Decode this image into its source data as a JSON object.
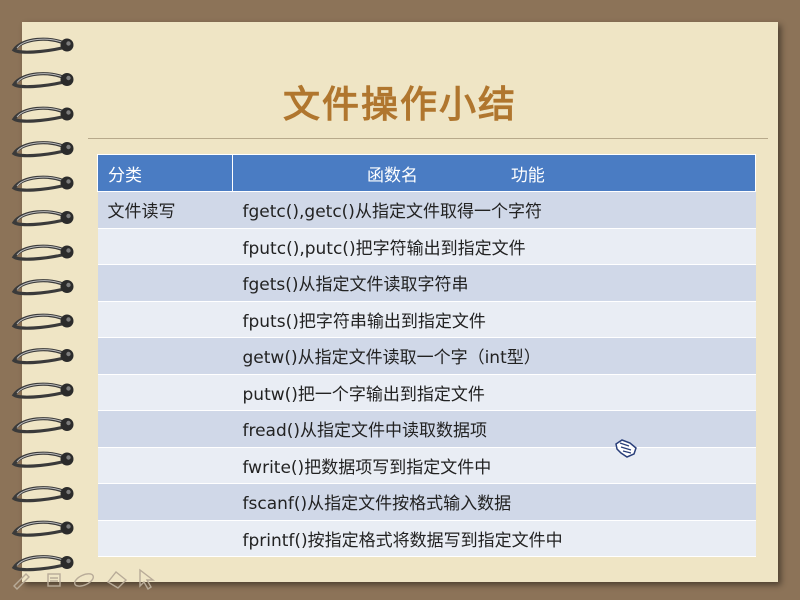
{
  "slide": {
    "title": "文件操作小结"
  },
  "table": {
    "headers": {
      "category": "分类",
      "function_name": "函数名",
      "purpose": "功能"
    },
    "rows": [
      {
        "category": "文件读写",
        "text": "fgetc(),getc()从指定文件取得一个字符"
      },
      {
        "category": "",
        "text": "fputc(),putc()把字符输出到指定文件"
      },
      {
        "category": "",
        "text": "fgets()从指定文件读取字符串"
      },
      {
        "category": "",
        "text": "fputs()把字符串输出到指定文件"
      },
      {
        "category": "",
        "text": "getw()从指定文件读取一个字（int型）"
      },
      {
        "category": "",
        "text": "putw()把一个字输出到指定文件"
      },
      {
        "category": "",
        "text": "fread()从指定文件中读取数据项"
      },
      {
        "category": "",
        "text": "fwrite()把数据项写到指定文件中"
      },
      {
        "category": "",
        "text": "fscanf()从指定文件按格式输入数据"
      },
      {
        "category": "",
        "text": "fprintf()按指定格式将数据写到指定文件中"
      }
    ]
  },
  "toolbar": {
    "icons": [
      "pen-icon",
      "slides-icon",
      "highlighter-icon",
      "eraser-icon",
      "pointer-icon"
    ]
  },
  "colors": {
    "title": "#b0762e",
    "header_bg": "#4a7cc3",
    "row_odd": "#d0d8e8",
    "row_even": "#e9edf4",
    "paper": "#efe5c5",
    "background": "#8c7358"
  }
}
